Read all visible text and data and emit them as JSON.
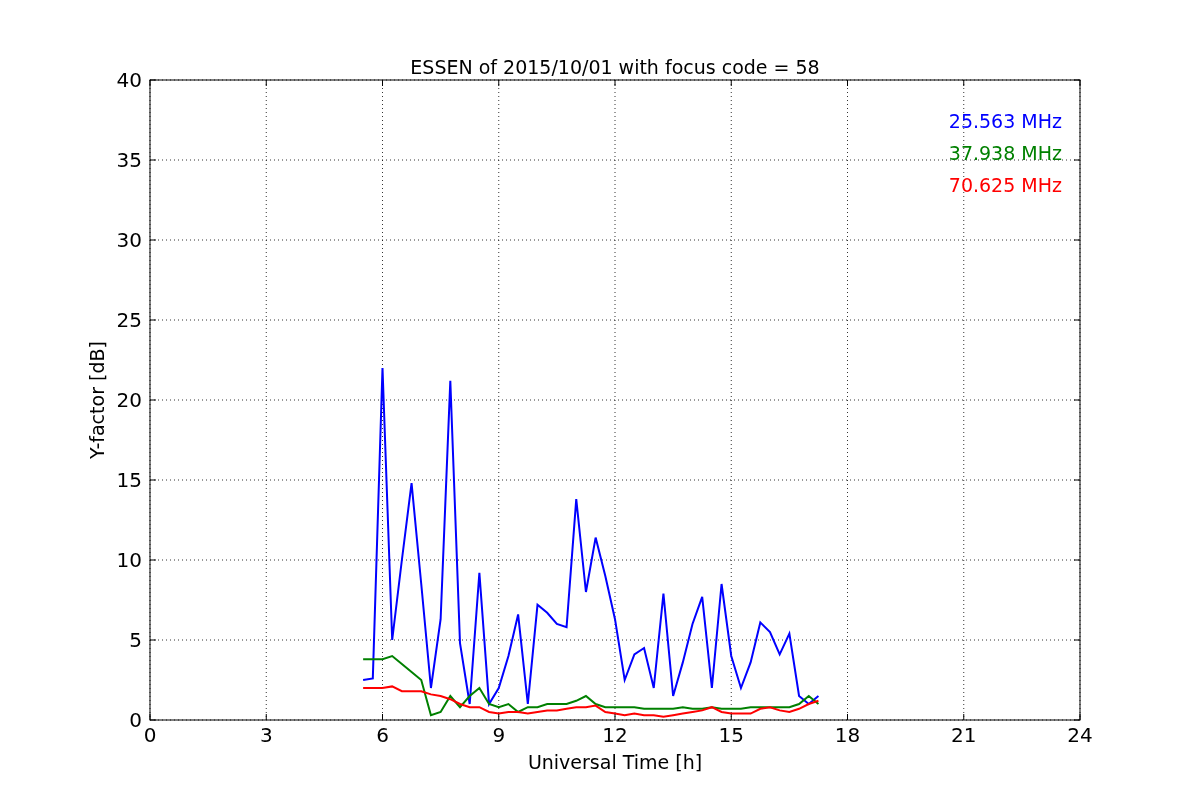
{
  "chart": {
    "chart_data": {
      "type": "line",
      "title": "ESSEN of 2015/10/01 with focus code = 58",
      "xlabel": "Universal Time [h]",
      "ylabel": "Y-factor [dB]",
      "x": [
        5.5,
        5.75,
        6.0,
        6.25,
        6.5,
        6.75,
        7.0,
        7.25,
        7.5,
        7.75,
        8.0,
        8.25,
        8.5,
        8.75,
        9.0,
        9.25,
        9.5,
        9.75,
        10.0,
        10.25,
        10.5,
        10.75,
        11.0,
        11.25,
        11.5,
        11.75,
        12.0,
        12.25,
        12.5,
        12.75,
        13.0,
        13.25,
        13.5,
        13.75,
        14.0,
        14.25,
        14.5,
        14.75,
        15.0,
        15.25,
        15.5,
        15.75,
        16.0,
        16.25,
        16.5,
        16.75,
        17.0,
        17.25
      ],
      "series": [
        {
          "name": "25.563 MHz",
          "color": "#0000ff",
          "values": [
            2.5,
            2.6,
            22.0,
            5.0,
            10.0,
            14.8,
            8.5,
            2.0,
            6.3,
            21.2,
            4.8,
            1.0,
            9.2,
            1.0,
            2.0,
            4.0,
            6.6,
            1.0,
            7.2,
            6.7,
            6.0,
            5.8,
            13.8,
            8.0,
            11.4,
            9.0,
            6.3,
            2.5,
            4.1,
            4.5,
            2.0,
            7.9,
            1.5,
            3.6,
            6.0,
            7.7,
            2.0,
            8.5,
            4.0,
            2.0,
            3.6,
            6.1,
            5.5,
            4.1,
            5.4,
            1.5,
            1.0,
            1.5
          ]
        },
        {
          "name": "37.938 MHz",
          "color": "#008000",
          "values": [
            3.8,
            3.8,
            3.8,
            4.0,
            3.5,
            3.0,
            2.5,
            0.3,
            0.5,
            1.5,
            0.8,
            1.5,
            2.0,
            1.0,
            0.8,
            1.0,
            0.5,
            0.8,
            0.8,
            1.0,
            1.0,
            1.0,
            1.2,
            1.5,
            1.0,
            0.8,
            0.8,
            0.8,
            0.8,
            0.7,
            0.7,
            0.7,
            0.7,
            0.8,
            0.7,
            0.7,
            0.8,
            0.7,
            0.7,
            0.7,
            0.8,
            0.8,
            0.8,
            0.8,
            0.8,
            1.0,
            1.5,
            1.0
          ]
        },
        {
          "name": "70.625 MHz",
          "color": "#ff0000",
          "values": [
            2.0,
            2.0,
            2.0,
            2.1,
            1.8,
            1.8,
            1.8,
            1.6,
            1.5,
            1.3,
            1.0,
            0.8,
            0.8,
            0.5,
            0.4,
            0.5,
            0.5,
            0.4,
            0.5,
            0.6,
            0.6,
            0.7,
            0.8,
            0.8,
            0.9,
            0.5,
            0.4,
            0.3,
            0.4,
            0.3,
            0.3,
            0.2,
            0.3,
            0.4,
            0.5,
            0.6,
            0.8,
            0.5,
            0.4,
            0.4,
            0.4,
            0.7,
            0.8,
            0.6,
            0.5,
            0.7,
            1.0,
            1.2
          ]
        }
      ],
      "grid": true,
      "xlim": [
        0,
        24
      ],
      "ylim": [
        0,
        40
      ],
      "xticks": [
        0,
        3,
        6,
        9,
        12,
        15,
        18,
        21,
        24
      ],
      "yticks": [
        0,
        5,
        10,
        15,
        20,
        25,
        30,
        35,
        40
      ]
    }
  }
}
